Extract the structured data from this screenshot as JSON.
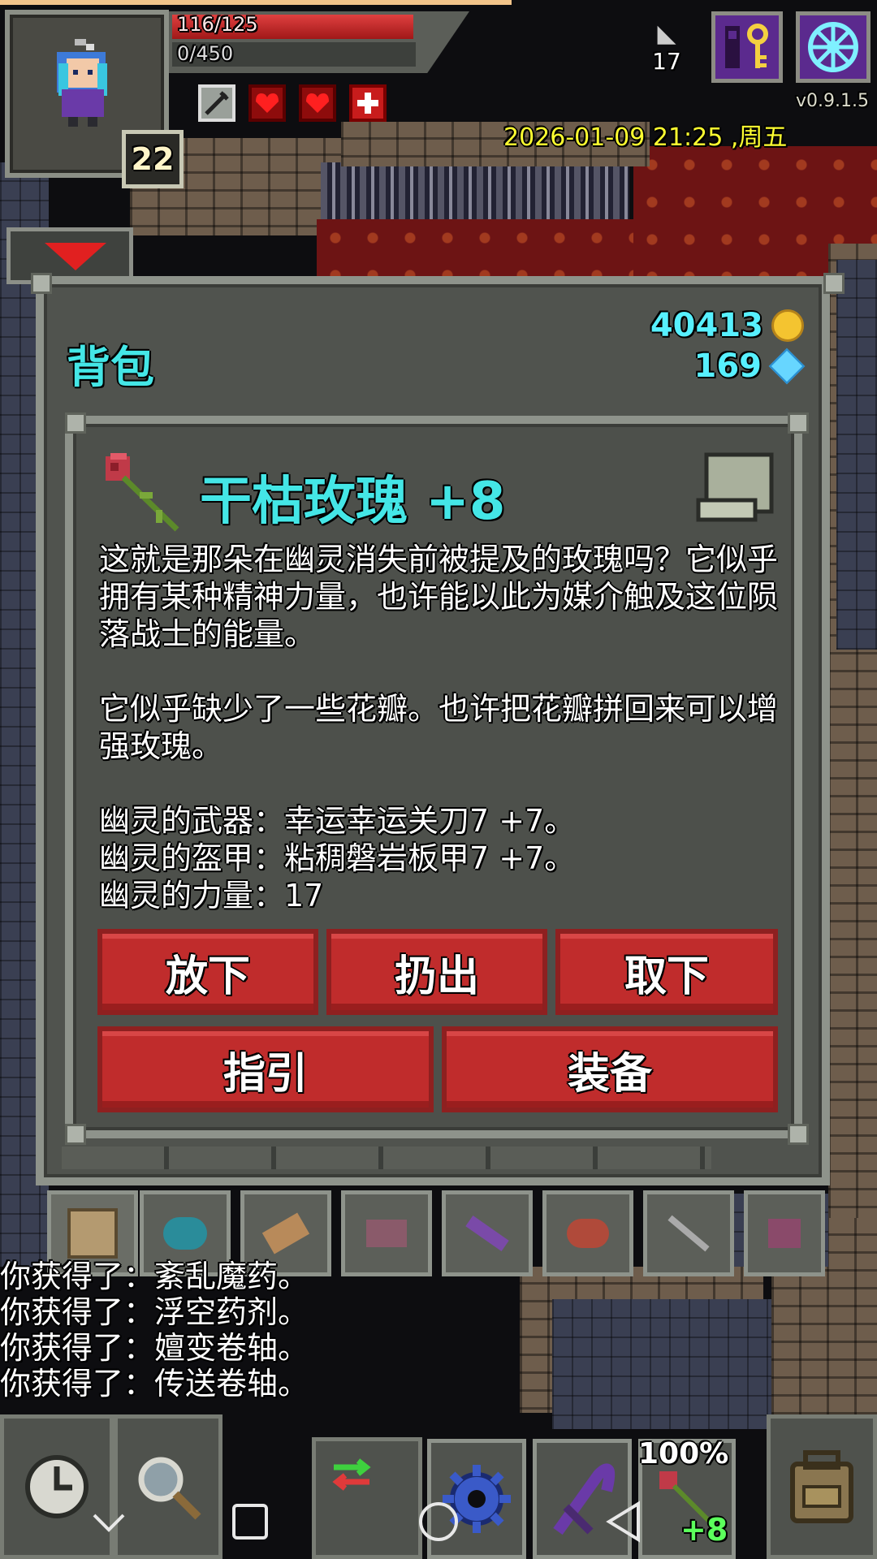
{
  "hud": {
    "hp_text": "116/125",
    "hp_fraction": 0.928,
    "exp_text": "0/450",
    "exp_fraction": 0.0,
    "hero_level": "22",
    "depth": "17",
    "version": "v0.9.1.5",
    "datetime": "2026-01-09 21:25 ,周五",
    "buffs": [
      "sword-buff-icon",
      "heart-buff-icon",
      "heart-buff-icon",
      "cross-buff-icon"
    ]
  },
  "backpack": {
    "title": "背包",
    "gold": "40413",
    "gems": "169"
  },
  "item": {
    "name": "干枯玫瑰",
    "upgrade": "+8",
    "description": [
      "这就是那朵在幽灵消失前被提及的玫瑰吗？它似乎拥有某种精神力量，也许能以此为媒介触及这位陨落战士的能量。",
      "它似乎缺少了一些花瓣。也许把花瓣拼回来可以增强玫瑰。",
      "幽灵的武器：幸运幸运关刀7 +7。",
      "幽灵的盔甲：粘稠磐岩板甲7 +7。",
      "幽灵的力量：17"
    ],
    "buttons": {
      "drop": "放下",
      "throw": "扔出",
      "unequip": "取下",
      "guide": "指引",
      "equip": "装备"
    }
  },
  "log": [
    "你获得了：紊乱魔药。",
    "你获得了：浮空药剂。",
    "你获得了：嬗变卷轴。",
    "你获得了：传送卷轴。"
  ],
  "quickslot": {
    "percent": "100%",
    "item_level": "+8"
  },
  "colors": {
    "accent_cyan": "#44e6e6",
    "button_red": "#c02c2c",
    "datetime_yellow": "#ffff30"
  }
}
